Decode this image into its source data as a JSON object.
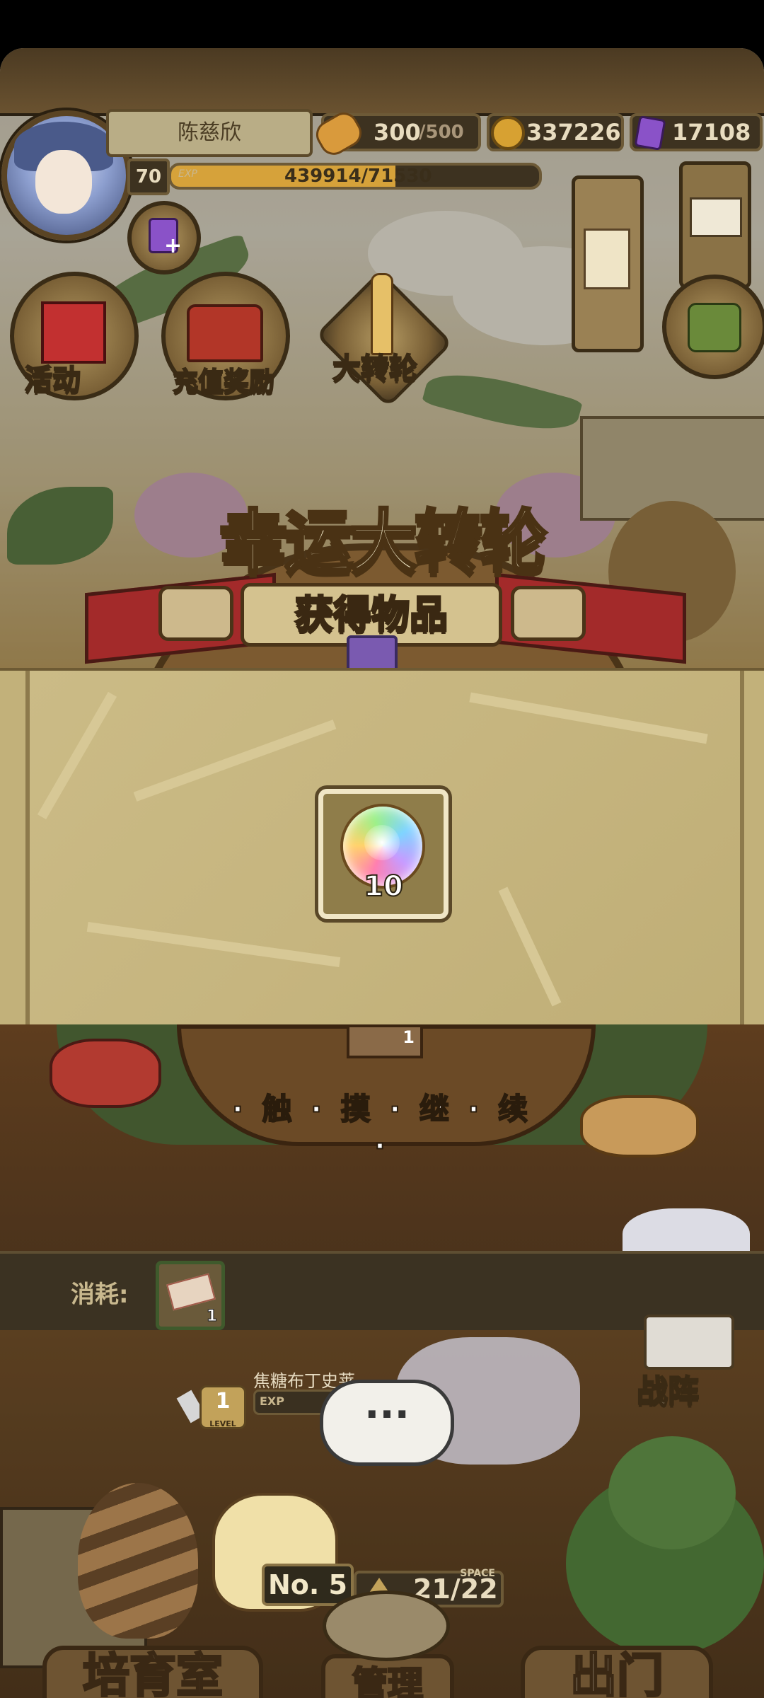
{
  "player": {
    "name": "陈慈欣",
    "level": "70",
    "exp_label": "EXP",
    "exp_text": "439914/71530",
    "exp_progress": 0.61
  },
  "resources": {
    "stamina": "300",
    "stamina_max": "/500",
    "gold": "337226",
    "gems": "17108"
  },
  "menu": {
    "activity": "活动",
    "recharge_reward": "充值奖励",
    "big_wheel": "大转轮"
  },
  "wheel": {
    "title": "幸运大转轮",
    "obtained": "获得物品"
  },
  "reward": {
    "count": "10"
  },
  "prompt": {
    "touch_continue": "· 触 · 摸 · 继 · 续 ·"
  },
  "consume": {
    "label": "消耗:",
    "ticket_count": "1",
    "wheel_ticket_count": "1"
  },
  "pet": {
    "name": "焦糖布丁史莱",
    "level": "1",
    "level_label": "LEVEL",
    "exp_label": "EXP",
    "speech": "···"
  },
  "farm": {
    "number": "No. 5",
    "space_label": "SPACE",
    "space": "21/22"
  },
  "nav": {
    "formation": "战阵",
    "nursery": "培育室",
    "manage": "管理",
    "exit": "出门"
  },
  "colors": {
    "frame_brown": "#4a3418",
    "panel_tan": "#c2b17a",
    "accent_red": "#a32a2a",
    "gold": "#d6a23a"
  }
}
